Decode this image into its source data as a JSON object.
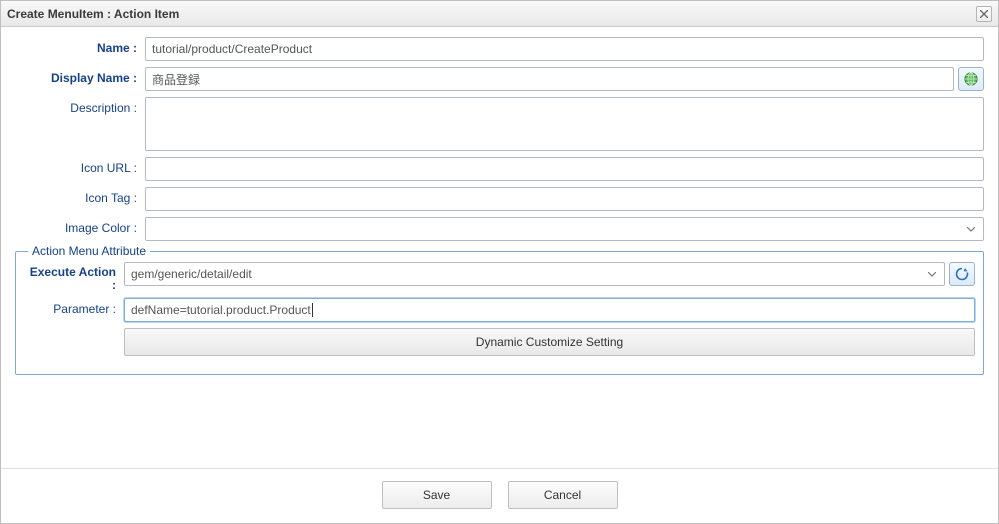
{
  "window": {
    "title": "Create MenuItem : Action Item",
    "close_tooltip": "Close"
  },
  "form": {
    "name": {
      "label": "Name :",
      "value": "tutorial/product/CreateProduct"
    },
    "display_name": {
      "label": "Display Name :",
      "value": "商品登録"
    },
    "description": {
      "label": "Description :",
      "value": ""
    },
    "icon_url": {
      "label": "Icon URL :",
      "value": ""
    },
    "icon_tag": {
      "label": "Icon Tag :",
      "value": ""
    },
    "image_color": {
      "label": "Image Color :",
      "value": ""
    }
  },
  "fieldset": {
    "legend": "Action Menu Attribute",
    "execute_action": {
      "label": "Execute Action :",
      "value": "gem/generic/detail/edit"
    },
    "parameter": {
      "label": "Parameter :",
      "value": "defName=tutorial.product.Product"
    },
    "dynamic_button": "Dynamic Customize Setting"
  },
  "buttons": {
    "save": "Save",
    "cancel": "Cancel"
  }
}
